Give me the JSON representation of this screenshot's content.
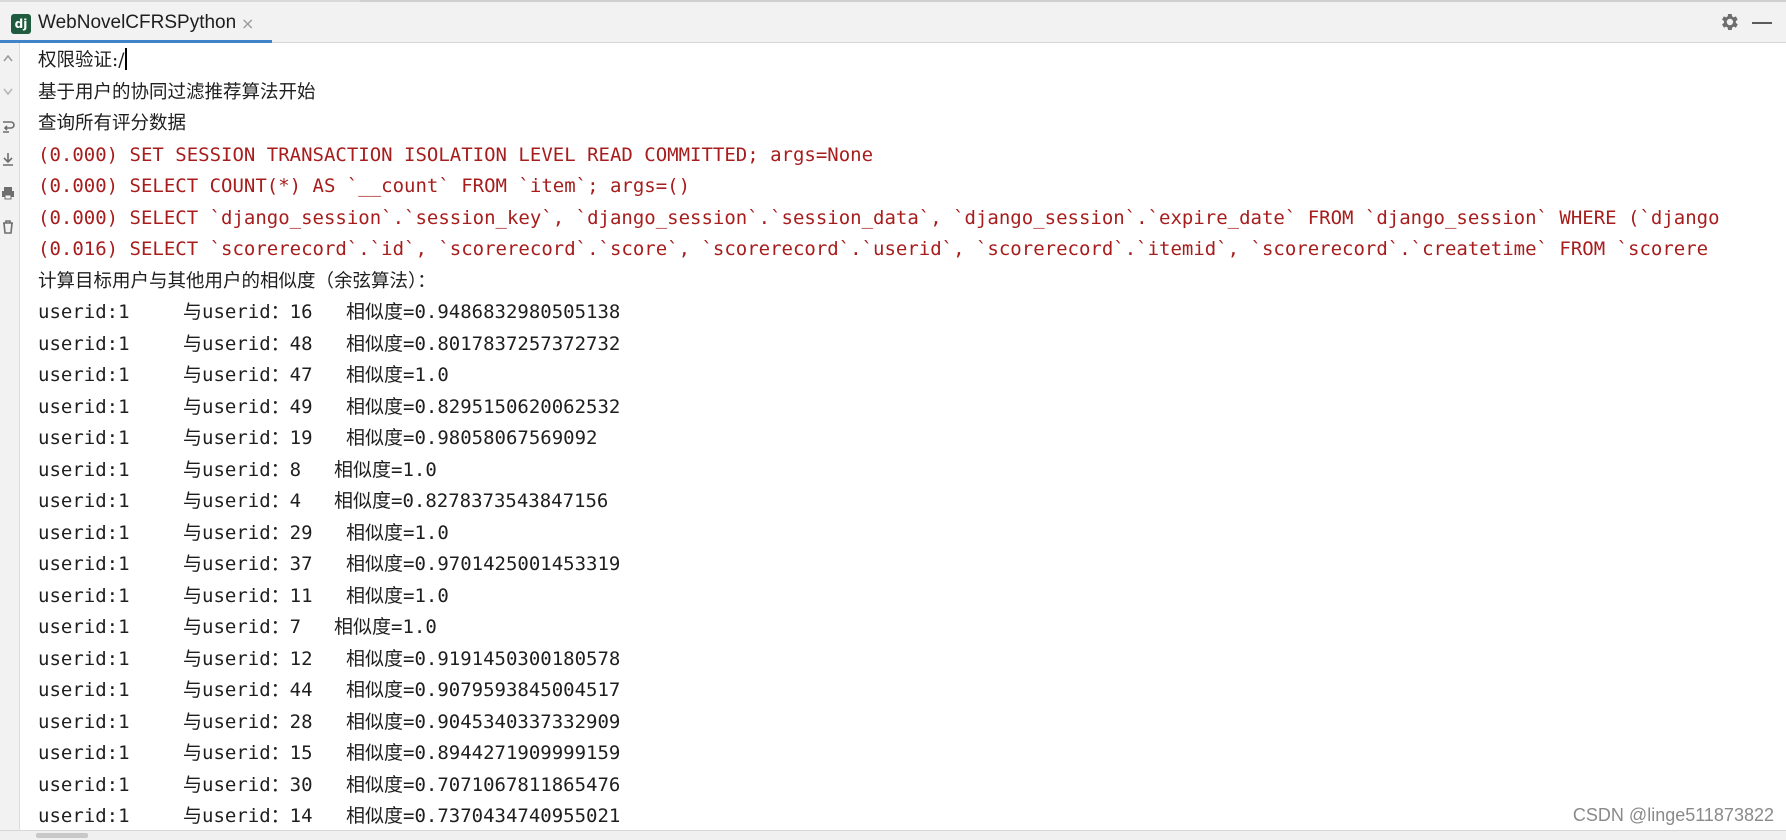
{
  "window": {
    "tab_icon_text": "dj",
    "tab_title": "WebNovelCFRSPython",
    "tab_close": "×"
  },
  "console": {
    "lines_text": [
      "权限验证:/",
      "基于用户的协同过滤推荐算法开始",
      "查询所有评分数据"
    ],
    "sql_lines": [
      "(0.000) SET SESSION TRANSACTION ISOLATION LEVEL READ COMMITTED; args=None",
      "(0.000) SELECT COUNT(*) AS `__count` FROM `item`; args=()",
      "(0.000) SELECT `django_session`.`session_key`, `django_session`.`session_data`, `django_session`.`expire_date` FROM `django_session` WHERE (`django",
      "(0.016) SELECT `scorerecord`.`id`, `scorerecord`.`score`, `scorerecord`.`userid`, `scorerecord`.`itemid`, `scorerecord`.`createtime` FROM `scorere"
    ],
    "similarity_header": "计算目标用户与其他用户的相似度（余弦算法）：",
    "rows": [
      {
        "a": "userid:1",
        "b": "与userid：16",
        "c": "相似度=0.9486832980505138",
        "short": false
      },
      {
        "a": "userid:1",
        "b": "与userid：48",
        "c": "相似度=0.8017837257372732",
        "short": false
      },
      {
        "a": "userid:1",
        "b": "与userid：47",
        "c": "相似度=1.0",
        "short": false
      },
      {
        "a": "userid:1",
        "b": "与userid：49",
        "c": "相似度=0.8295150620062532",
        "short": false
      },
      {
        "a": "userid:1",
        "b": "与userid：19",
        "c": "相似度=0.98058067569092",
        "short": false
      },
      {
        "a": "userid:1",
        "b": "与userid：8",
        "c": "相似度=1.0",
        "short": true
      },
      {
        "a": "userid:1",
        "b": "与userid：4",
        "c": "相似度=0.8278373543847156",
        "short": true
      },
      {
        "a": "userid:1",
        "b": "与userid：29",
        "c": "相似度=1.0",
        "short": false
      },
      {
        "a": "userid:1",
        "b": "与userid：37",
        "c": "相似度=0.9701425001453319",
        "short": false
      },
      {
        "a": "userid:1",
        "b": "与userid：11",
        "c": "相似度=1.0",
        "short": false
      },
      {
        "a": "userid:1",
        "b": "与userid：7",
        "c": "相似度=1.0",
        "short": true
      },
      {
        "a": "userid:1",
        "b": "与userid：12",
        "c": "相似度=0.9191450300180578",
        "short": false
      },
      {
        "a": "userid:1",
        "b": "与userid：44",
        "c": "相似度=0.9079593845004517",
        "short": false
      },
      {
        "a": "userid:1",
        "b": "与userid：28",
        "c": "相似度=0.9045340337332909",
        "short": false
      },
      {
        "a": "userid:1",
        "b": "与userid：15",
        "c": "相似度=0.8944271909999159",
        "short": false
      },
      {
        "a": "userid:1",
        "b": "与userid：30",
        "c": "相似度=0.7071067811865476",
        "short": false
      },
      {
        "a": "userid:1",
        "b": "与userid：14",
        "c": "相似度=0.7370434740955021",
        "short": false
      }
    ]
  },
  "watermark": "CSDN @linge511873822",
  "icons": {
    "tab_icon": "django-icon",
    "settings": "gear-icon",
    "minimize": "minimize-icon",
    "gutter": [
      "up-arrow-icon",
      "soft-wrap-icon",
      "scroll-to-end-icon",
      "print-icon",
      "trash-icon"
    ]
  },
  "colors": {
    "sql_text": "#a71d1d",
    "tab_accent": "#4083c9",
    "default_text": "#1e1e1e"
  }
}
